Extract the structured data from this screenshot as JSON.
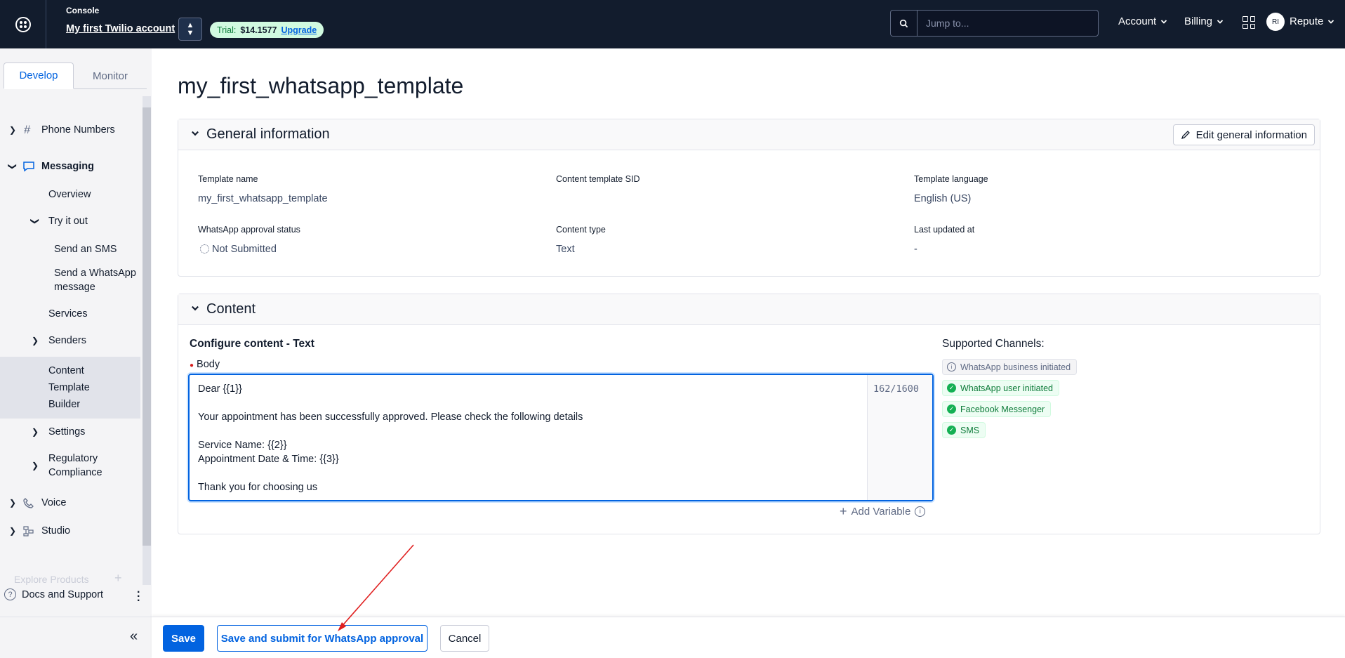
{
  "topbar": {
    "console_label": "Console",
    "account_name": "My first Twilio account",
    "trial_label": "Trial:",
    "trial_balance": "$14.1577",
    "upgrade_label": "Upgrade",
    "search_placeholder": "Jump to...",
    "account_menu": "Account",
    "billing_menu": "Billing",
    "avatar_initials": "RI",
    "user_name": "Repute"
  },
  "sidebar": {
    "tabs": [
      "Develop",
      "Monitor"
    ],
    "items": {
      "phone_numbers": "Phone Numbers",
      "messaging": "Messaging",
      "overview": "Overview",
      "try_it_out": "Try it out",
      "send_sms": "Send an SMS",
      "send_whatsapp": "Send a WhatsApp message",
      "services": "Services",
      "senders": "Senders",
      "content_template_builder": "Content Template Builder",
      "settings": "Settings",
      "regulatory_compliance": "Regulatory Compliance",
      "voice": "Voice",
      "studio": "Studio"
    },
    "explore_products": "Explore Products",
    "docs_support": "Docs and Support"
  },
  "page": {
    "title": "my_first_whatsapp_template"
  },
  "general_info": {
    "heading": "General information",
    "edit_label": "Edit general information",
    "fields": {
      "template_name_label": "Template name",
      "template_name_value": "my_first_whatsapp_template",
      "sid_label": "Content template SID",
      "sid_value": "",
      "language_label": "Template language",
      "language_value": "English (US)",
      "approval_label": "WhatsApp approval status",
      "approval_value": "Not Submitted",
      "content_type_label": "Content type",
      "content_type_value": "Text",
      "updated_label": "Last updated at",
      "updated_value": "-"
    }
  },
  "content": {
    "heading": "Content",
    "configure_title": "Configure content - Text",
    "body_label": "Body",
    "body_lines": [
      "Dear {{1}}",
      "",
      "Your appointment has been successfully approved. Please check the following details",
      "",
      "Service Name: {{2}}",
      "Appointment Date & Time: {{3}}",
      "",
      "Thank you for choosing us"
    ],
    "char_count": "162/1600",
    "add_variable": "Add Variable",
    "channels_title": "Supported Channels:",
    "channels": [
      {
        "label": "WhatsApp business initiated",
        "status": "info"
      },
      {
        "label": "WhatsApp user initiated",
        "status": "supported"
      },
      {
        "label": "Facebook Messenger",
        "status": "supported"
      },
      {
        "label": "SMS",
        "status": "supported"
      }
    ]
  },
  "footer": {
    "save": "Save",
    "save_submit": "Save and submit for WhatsApp approval",
    "cancel": "Cancel"
  },
  "colors": {
    "topbar_bg": "#121c2d",
    "primary": "#0263e0",
    "success": "#14b053",
    "annotation_arrow": "#e02020"
  }
}
